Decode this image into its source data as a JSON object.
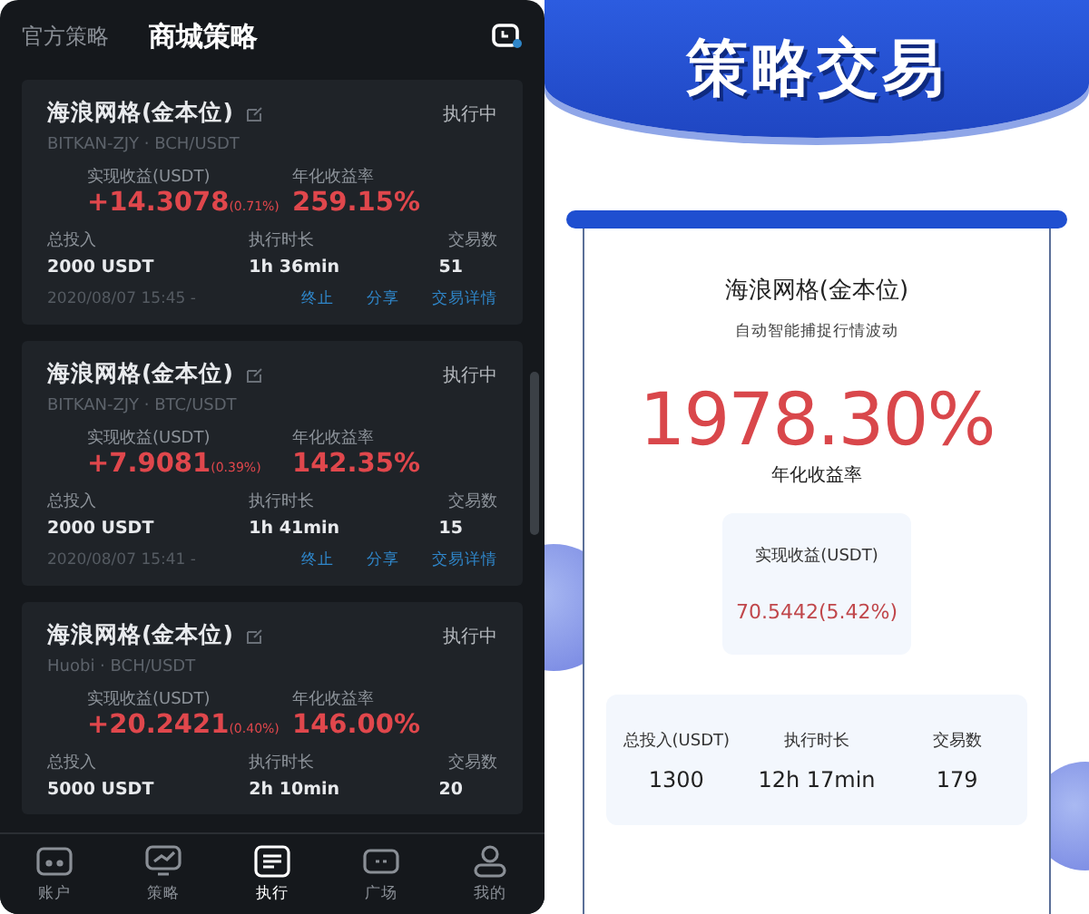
{
  "header": {
    "tabs": [
      {
        "label": "官方策略",
        "selected": false
      },
      {
        "label": "商城策略",
        "selected": true
      }
    ]
  },
  "strategies": [
    {
      "name": "海浪网格(金本位)",
      "status": "执行中",
      "source": "BITKAN-ZJY · BCH/USDT",
      "profit_label": "实现收益(USDT)",
      "profit": "+14.3078",
      "profit_pct": "(0.71%)",
      "annual_label": "年化收益率",
      "annual": "259.15%",
      "stats": [
        {
          "label": "总投入",
          "value": "2000 USDT"
        },
        {
          "label": "执行时长",
          "value": "1h 36min"
        },
        {
          "label": "交易数",
          "value": "51"
        }
      ],
      "time": "2020/08/07 15:45 -",
      "actions": [
        "终止",
        "分享",
        "交易详情"
      ]
    },
    {
      "name": "海浪网格(金本位)",
      "status": "执行中",
      "source": "BITKAN-ZJY · BTC/USDT",
      "profit_label": "实现收益(USDT)",
      "profit": "+7.9081",
      "profit_pct": "(0.39%)",
      "annual_label": "年化收益率",
      "annual": "142.35%",
      "stats": [
        {
          "label": "总投入",
          "value": "2000 USDT"
        },
        {
          "label": "执行时长",
          "value": "1h 41min"
        },
        {
          "label": "交易数",
          "value": "15"
        }
      ],
      "time": "2020/08/07 15:41 -",
      "actions": [
        "终止",
        "分享",
        "交易详情"
      ]
    },
    {
      "name": "海浪网格(金本位)",
      "status": "执行中",
      "source": "Huobi · BCH/USDT",
      "profit_label": "实现收益(USDT)",
      "profit": "+20.2421",
      "profit_pct": "(0.40%)",
      "annual_label": "年化收益率",
      "annual": "146.00%",
      "stats": [
        {
          "label": "总投入",
          "value": "5000 USDT"
        },
        {
          "label": "执行时长",
          "value": "2h 10min"
        },
        {
          "label": "交易数",
          "value": "20"
        }
      ]
    }
  ],
  "nav": [
    {
      "kind": "account",
      "label": "账户",
      "selected": false
    },
    {
      "kind": "strategy",
      "label": "策略",
      "selected": false
    },
    {
      "kind": "execute",
      "label": "执行",
      "selected": true
    },
    {
      "kind": "plaza",
      "label": "广场",
      "selected": false
    },
    {
      "kind": "mine",
      "label": "我的",
      "selected": false
    }
  ],
  "promo": {
    "banner_title": "策略交易",
    "name": "海浪网格(金本位)",
    "subtitle": "自动智能捕捉行情波动",
    "annual": "1978.30%",
    "annual_label": "年化收益率",
    "profit_label": "实现收益(USDT)",
    "profit": "70.5442(5.42%)",
    "stats": [
      {
        "label": "总投入(USDT)",
        "value": "1300"
      },
      {
        "label": "执行时长",
        "value": "12h 17min"
      },
      {
        "label": "交易数",
        "value": "179"
      }
    ]
  }
}
